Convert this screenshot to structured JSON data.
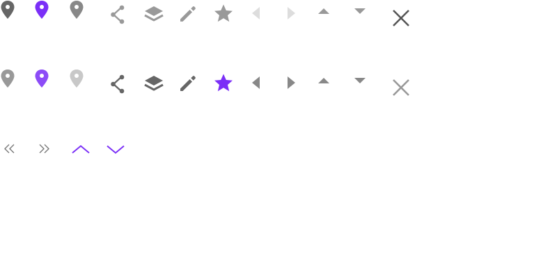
{
  "colors": {
    "dark_gray": "#666666",
    "mid_gray": "#888888",
    "soft_gray": "#999999",
    "light_gray": "#c8c8c8",
    "faint_gray": "#dddddd",
    "purple": "#7b2ff7",
    "purple_light": "#8c4cf7"
  },
  "rows": [
    {
      "name": "row-1",
      "icons": [
        {
          "icon": "map-pin-icon",
          "color": "#666666",
          "state": "default"
        },
        {
          "icon": "map-pin-icon",
          "color": "#7b2ff7",
          "state": "active"
        },
        {
          "icon": "map-pin-icon",
          "color": "#888888",
          "state": "default"
        },
        {
          "icon": "share-icon",
          "color": "#999999",
          "state": "default"
        },
        {
          "icon": "layers-icon",
          "color": "#999999",
          "state": "default"
        },
        {
          "icon": "pencil-icon",
          "color": "#999999",
          "state": "default"
        },
        {
          "icon": "star-icon",
          "color": "#999999",
          "state": "default"
        },
        {
          "icon": "caret-left-icon",
          "color": "#dddddd",
          "state": "disabled"
        },
        {
          "icon": "caret-right-icon",
          "color": "#dddddd",
          "state": "disabled"
        },
        {
          "icon": "caret-up-icon",
          "color": "#999999",
          "state": "default"
        },
        {
          "icon": "caret-down-icon",
          "color": "#999999",
          "state": "default"
        },
        {
          "icon": "close-icon",
          "color": "#555555",
          "state": "default"
        }
      ]
    },
    {
      "name": "row-2",
      "icons": [
        {
          "icon": "map-pin-icon",
          "color": "#999999",
          "state": "default"
        },
        {
          "icon": "map-pin-icon",
          "color": "#8c4cf7",
          "state": "hover"
        },
        {
          "icon": "map-pin-icon",
          "color": "#c8c8c8",
          "state": "disabled"
        },
        {
          "icon": "share-icon",
          "color": "#666666",
          "state": "hover"
        },
        {
          "icon": "layers-icon",
          "color": "#666666",
          "state": "hover"
        },
        {
          "icon": "pencil-icon",
          "color": "#666666",
          "state": "hover"
        },
        {
          "icon": "star-icon",
          "color": "#7b2ff7",
          "state": "active"
        },
        {
          "icon": "caret-left-icon",
          "color": "#888888",
          "state": "default"
        },
        {
          "icon": "caret-right-icon",
          "color": "#888888",
          "state": "default"
        },
        {
          "icon": "caret-up-icon",
          "color": "#888888",
          "state": "default"
        },
        {
          "icon": "caret-down-icon",
          "color": "#888888",
          "state": "default"
        },
        {
          "icon": "close-icon",
          "color": "#999999",
          "state": "default"
        }
      ]
    },
    {
      "name": "row-3",
      "icons": [
        {
          "icon": "double-chevron-left-icon",
          "color": "#777777",
          "state": "default"
        },
        {
          "icon": "double-chevron-right-icon",
          "color": "#777777",
          "state": "default"
        },
        {
          "icon": "chevron-up-icon",
          "color": "#7b2ff7",
          "state": "active"
        },
        {
          "icon": "chevron-down-icon",
          "color": "#7b2ff7",
          "state": "active"
        }
      ]
    }
  ]
}
